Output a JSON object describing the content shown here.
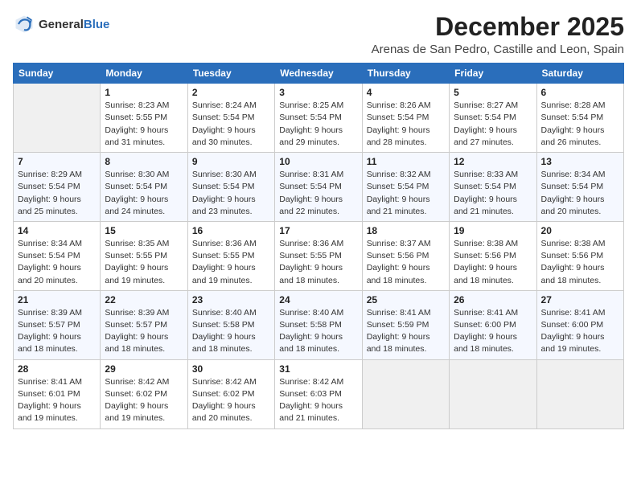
{
  "header": {
    "logo_general": "General",
    "logo_blue": "Blue",
    "month_year": "December 2025",
    "location": "Arenas de San Pedro, Castille and Leon, Spain"
  },
  "columns": [
    "Sunday",
    "Monday",
    "Tuesday",
    "Wednesday",
    "Thursday",
    "Friday",
    "Saturday"
  ],
  "weeks": [
    [
      {
        "day": "",
        "info": ""
      },
      {
        "day": "1",
        "info": "Sunrise: 8:23 AM\nSunset: 5:55 PM\nDaylight: 9 hours\nand 31 minutes."
      },
      {
        "day": "2",
        "info": "Sunrise: 8:24 AM\nSunset: 5:54 PM\nDaylight: 9 hours\nand 30 minutes."
      },
      {
        "day": "3",
        "info": "Sunrise: 8:25 AM\nSunset: 5:54 PM\nDaylight: 9 hours\nand 29 minutes."
      },
      {
        "day": "4",
        "info": "Sunrise: 8:26 AM\nSunset: 5:54 PM\nDaylight: 9 hours\nand 28 minutes."
      },
      {
        "day": "5",
        "info": "Sunrise: 8:27 AM\nSunset: 5:54 PM\nDaylight: 9 hours\nand 27 minutes."
      },
      {
        "day": "6",
        "info": "Sunrise: 8:28 AM\nSunset: 5:54 PM\nDaylight: 9 hours\nand 26 minutes."
      }
    ],
    [
      {
        "day": "7",
        "info": "Sunrise: 8:29 AM\nSunset: 5:54 PM\nDaylight: 9 hours\nand 25 minutes."
      },
      {
        "day": "8",
        "info": "Sunrise: 8:30 AM\nSunset: 5:54 PM\nDaylight: 9 hours\nand 24 minutes."
      },
      {
        "day": "9",
        "info": "Sunrise: 8:30 AM\nSunset: 5:54 PM\nDaylight: 9 hours\nand 23 minutes."
      },
      {
        "day": "10",
        "info": "Sunrise: 8:31 AM\nSunset: 5:54 PM\nDaylight: 9 hours\nand 22 minutes."
      },
      {
        "day": "11",
        "info": "Sunrise: 8:32 AM\nSunset: 5:54 PM\nDaylight: 9 hours\nand 21 minutes."
      },
      {
        "day": "12",
        "info": "Sunrise: 8:33 AM\nSunset: 5:54 PM\nDaylight: 9 hours\nand 21 minutes."
      },
      {
        "day": "13",
        "info": "Sunrise: 8:34 AM\nSunset: 5:54 PM\nDaylight: 9 hours\nand 20 minutes."
      }
    ],
    [
      {
        "day": "14",
        "info": "Sunrise: 8:34 AM\nSunset: 5:54 PM\nDaylight: 9 hours\nand 20 minutes."
      },
      {
        "day": "15",
        "info": "Sunrise: 8:35 AM\nSunset: 5:55 PM\nDaylight: 9 hours\nand 19 minutes."
      },
      {
        "day": "16",
        "info": "Sunrise: 8:36 AM\nSunset: 5:55 PM\nDaylight: 9 hours\nand 19 minutes."
      },
      {
        "day": "17",
        "info": "Sunrise: 8:36 AM\nSunset: 5:55 PM\nDaylight: 9 hours\nand 18 minutes."
      },
      {
        "day": "18",
        "info": "Sunrise: 8:37 AM\nSunset: 5:56 PM\nDaylight: 9 hours\nand 18 minutes."
      },
      {
        "day": "19",
        "info": "Sunrise: 8:38 AM\nSunset: 5:56 PM\nDaylight: 9 hours\nand 18 minutes."
      },
      {
        "day": "20",
        "info": "Sunrise: 8:38 AM\nSunset: 5:56 PM\nDaylight: 9 hours\nand 18 minutes."
      }
    ],
    [
      {
        "day": "21",
        "info": "Sunrise: 8:39 AM\nSunset: 5:57 PM\nDaylight: 9 hours\nand 18 minutes."
      },
      {
        "day": "22",
        "info": "Sunrise: 8:39 AM\nSunset: 5:57 PM\nDaylight: 9 hours\nand 18 minutes."
      },
      {
        "day": "23",
        "info": "Sunrise: 8:40 AM\nSunset: 5:58 PM\nDaylight: 9 hours\nand 18 minutes."
      },
      {
        "day": "24",
        "info": "Sunrise: 8:40 AM\nSunset: 5:58 PM\nDaylight: 9 hours\nand 18 minutes."
      },
      {
        "day": "25",
        "info": "Sunrise: 8:41 AM\nSunset: 5:59 PM\nDaylight: 9 hours\nand 18 minutes."
      },
      {
        "day": "26",
        "info": "Sunrise: 8:41 AM\nSunset: 6:00 PM\nDaylight: 9 hours\nand 18 minutes."
      },
      {
        "day": "27",
        "info": "Sunrise: 8:41 AM\nSunset: 6:00 PM\nDaylight: 9 hours\nand 19 minutes."
      }
    ],
    [
      {
        "day": "28",
        "info": "Sunrise: 8:41 AM\nSunset: 6:01 PM\nDaylight: 9 hours\nand 19 minutes."
      },
      {
        "day": "29",
        "info": "Sunrise: 8:42 AM\nSunset: 6:02 PM\nDaylight: 9 hours\nand 19 minutes."
      },
      {
        "day": "30",
        "info": "Sunrise: 8:42 AM\nSunset: 6:02 PM\nDaylight: 9 hours\nand 20 minutes."
      },
      {
        "day": "31",
        "info": "Sunrise: 8:42 AM\nSunset: 6:03 PM\nDaylight: 9 hours\nand 21 minutes."
      },
      {
        "day": "",
        "info": ""
      },
      {
        "day": "",
        "info": ""
      },
      {
        "day": "",
        "info": ""
      }
    ]
  ]
}
